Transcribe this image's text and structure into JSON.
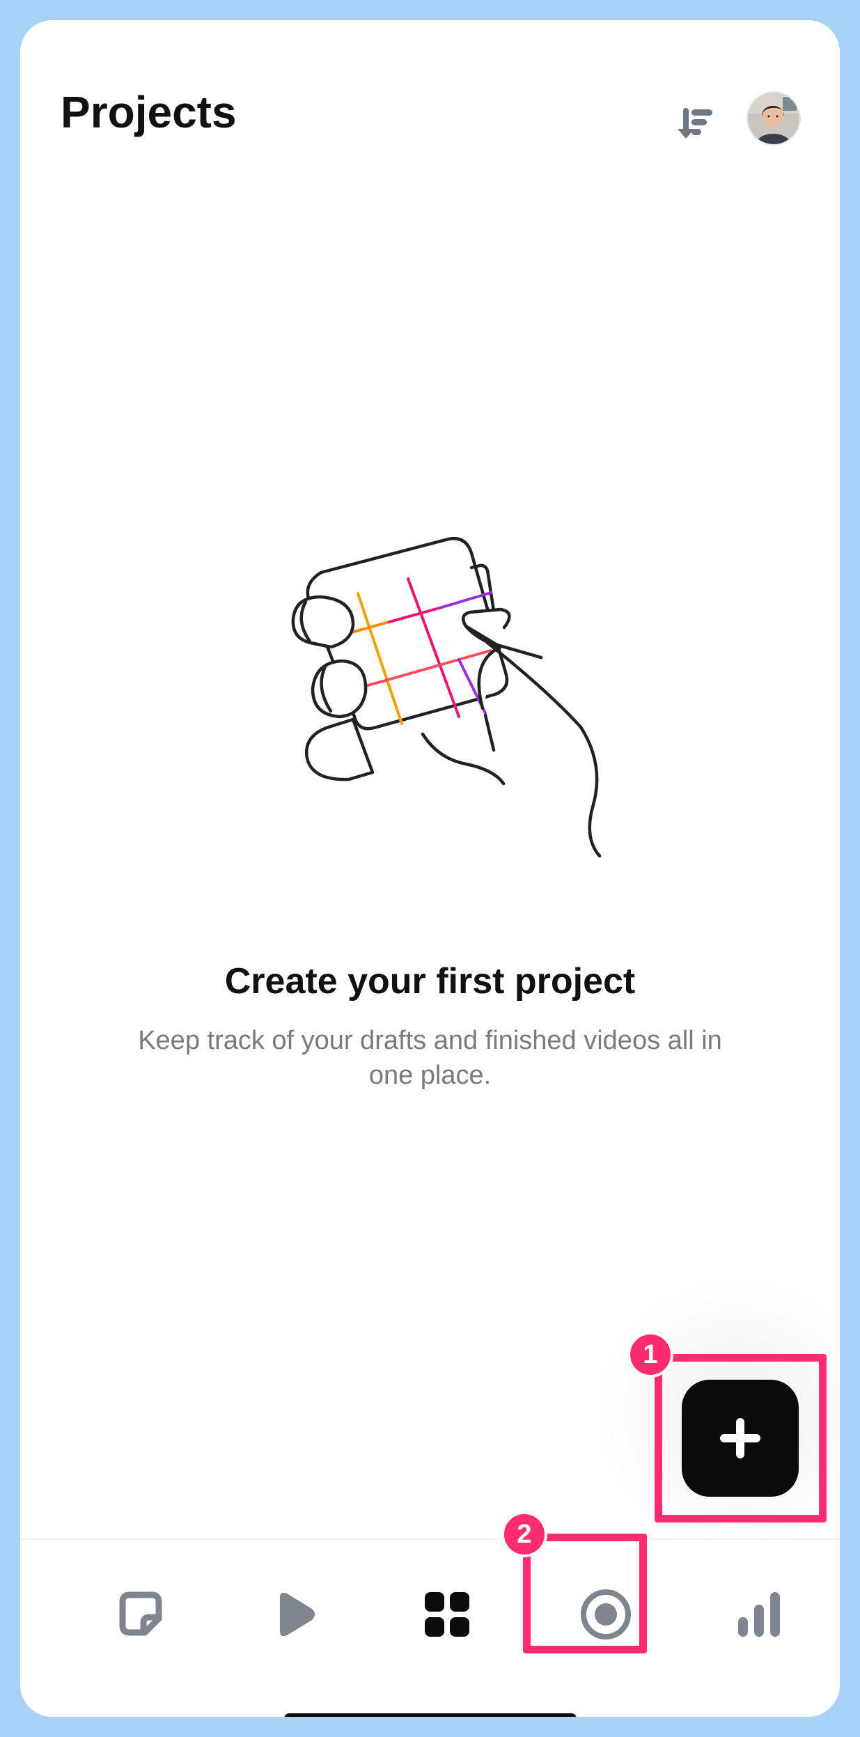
{
  "header": {
    "title": "Projects",
    "sort_icon": "sort-download-icon",
    "avatar_icon": "profile-avatar"
  },
  "empty_state": {
    "title": "Create your first project",
    "description": "Keep track of your drafts and finished videos all in one place.",
    "illustration": "hand-holding-phone-illustration"
  },
  "fab": {
    "icon": "plus-icon",
    "badge": "1"
  },
  "tabbar": {
    "items": [
      {
        "icon": "note-icon"
      },
      {
        "icon": "play-icon"
      },
      {
        "icon": "grid-icon"
      },
      {
        "icon": "record-icon",
        "badge": "2"
      },
      {
        "icon": "bar-chart-icon"
      }
    ]
  },
  "colors": {
    "background": "#a8d3f7",
    "highlight": "#ff2d6f",
    "primary_text": "#111111",
    "secondary_text": "#7a7a7a",
    "fab": "#0b0b0c"
  }
}
